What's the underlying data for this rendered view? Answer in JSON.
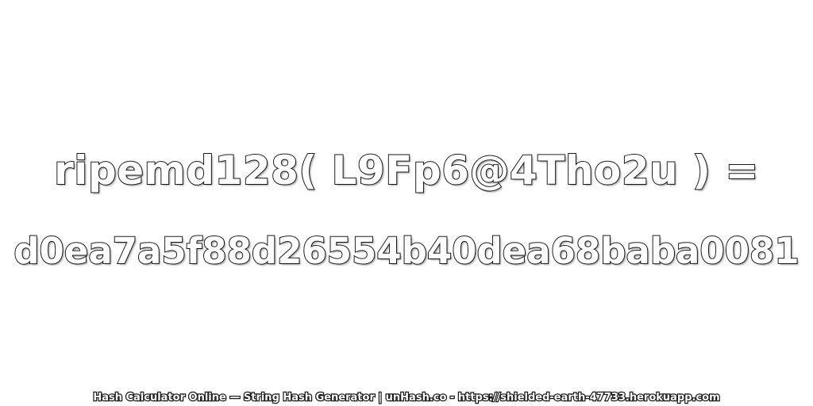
{
  "expression": "ripemd128( L9Fp6@4Tho2u ) =",
  "hash_value": "d0ea7a5f88d26554b40dea68baba0081",
  "footer": "Hash Calculator Online — String Hash Generator | unHash.co - https://shielded-earth-47733.herokuapp.com",
  "colors": {
    "background": "#ffffff",
    "text_fill": "#ffffff",
    "text_outline": "#1a1a1a"
  }
}
